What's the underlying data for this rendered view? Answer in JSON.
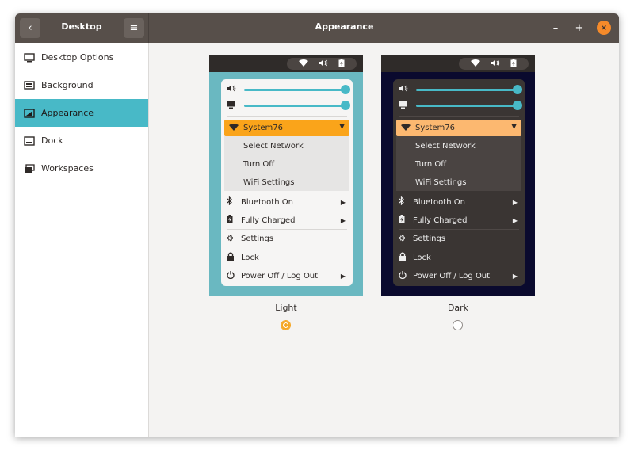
{
  "titlebar": {
    "left_title": "Desktop",
    "title": "Appearance",
    "back_glyph": "‹",
    "menu_glyph": "≡",
    "min_glyph": "–",
    "max_glyph": "+",
    "close_glyph": "×"
  },
  "sidebar": {
    "items": [
      {
        "label": "Desktop Options",
        "icon": "monitor-icon"
      },
      {
        "label": "Background",
        "icon": "image-icon"
      },
      {
        "label": "Appearance",
        "icon": "appearance-icon"
      },
      {
        "label": "Dock",
        "icon": "dock-icon"
      },
      {
        "label": "Workspaces",
        "icon": "workspaces-icon"
      }
    ],
    "active_index": 2
  },
  "preview_menu": {
    "network": "System76",
    "network_items": [
      "Select Network",
      "Turn Off",
      "WiFi Settings"
    ],
    "bluetooth": "Bluetooth On",
    "battery": "Fully Charged",
    "settings": "Settings",
    "lock": "Lock",
    "power": "Power Off / Log Out"
  },
  "themes": {
    "light": {
      "label": "Light",
      "selected": true
    },
    "dark": {
      "label": "Dark",
      "selected": false
    }
  },
  "colors": {
    "accent": "#48b9c7",
    "highlight_light": "#faa41a",
    "highlight_dark": "#fcb870",
    "titlebar": "#574f4a"
  }
}
